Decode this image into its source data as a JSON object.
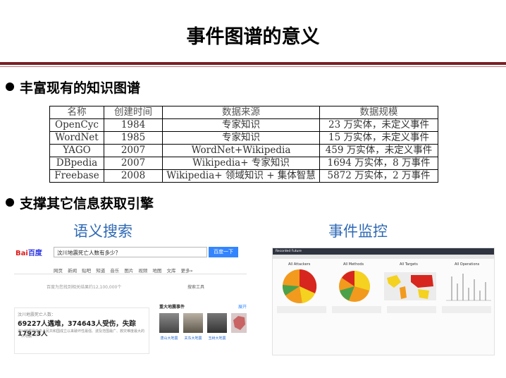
{
  "title": "事件图谱的意义",
  "section1": "丰富现有的知识图谱",
  "section2": "支撑其它信息获取引擎",
  "table": {
    "headers": [
      "名称",
      "创建时间",
      "数据来源",
      "数据规模"
    ],
    "rows": [
      [
        "OpenCyc",
        "1984",
        "专家知识",
        "23 万实体，未定义事件"
      ],
      [
        "WordNet",
        "1985",
        "专家知识",
        "15 万实体，未定义事件"
      ],
      [
        "YAGO",
        "2007",
        "WordNet+Wikipedia",
        "459 万实体，未定义事件"
      ],
      [
        "DBpedia",
        "2007",
        "Wikipedia+ 专家知识",
        "1694 万实体，8 万事件"
      ],
      [
        "Freebase",
        "2008",
        "Wikipedia+ 领域知识 + 集体智慧",
        "5872 万实体，2 万事件"
      ]
    ]
  },
  "captions": {
    "search": "语义搜索",
    "monitor": "事件监控"
  },
  "baidu": {
    "logo_red": "Bai",
    "logo_blue": "百度",
    "query": "汶川地震死亡人数有多少？",
    "search_button": "百度一下",
    "tabs": "网页 新闻 贴吧 知道 音乐 图片 视频 地图 文库 更多»",
    "result_count": "百度为您找到相关结果约12,100,000个",
    "tools": "搜索工具",
    "card_question": "汶川地震死亡人数：",
    "card_answer": "69227人遇难，374643人受伤，失踪17923人",
    "card_text": "汶川地震是中华人民共和国成立以来破坏性最强、波及范围最广、救灾难度最大的一次地震……",
    "right_title": "重大地震事件",
    "right_more": "展开",
    "thumbs": [
      "唐山大地震",
      "关东大地震",
      "玉树大地震"
    ],
    "colors": {
      "blue": "#2932e1",
      "red": "#de1b1b",
      "button": "#3385ff"
    }
  },
  "monitor": {
    "topbar": "Recorded Future",
    "panels": [
      "All Attackers",
      "All Methods",
      "All Targets",
      "All Operations"
    ],
    "colors": {
      "red": "#d7261e",
      "orange": "#f29a1d",
      "yellow": "#f4d21f",
      "green": "#4aa14a"
    }
  }
}
